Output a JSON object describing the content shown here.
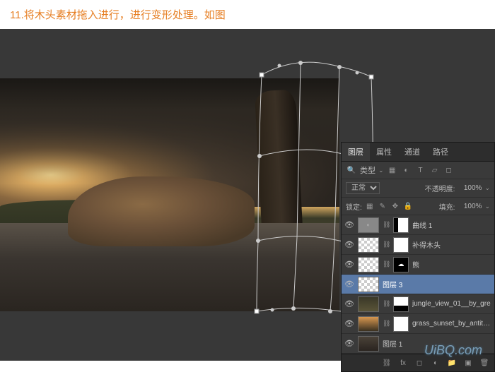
{
  "step": "11.将木头素材拖入进行，进行变形处理。如图",
  "watermark": "UiBQ.com",
  "panel": {
    "tabs": [
      "图层",
      "属性",
      "通道",
      "路径"
    ],
    "active_tab": "图层",
    "filter_label": "类型",
    "blend_mode": "正常",
    "opacity_label": "不透明度:",
    "opacity_value": "100%",
    "lock_label": "锁定:",
    "fill_label": "填充:",
    "fill_value": "100%"
  },
  "layers": [
    {
      "name": "曲线 1",
      "type": "adjust",
      "masked": true,
      "sel": false
    },
    {
      "name": "补得木头",
      "type": "trans",
      "masked": true,
      "sel": false
    },
    {
      "name": "熊",
      "type": "trans",
      "masked": true,
      "sel": false
    },
    {
      "name": "图层 3",
      "type": "trans",
      "masked": false,
      "sel": true
    },
    {
      "name": "jungle_view_01__by_gre",
      "type": "img1",
      "masked": true,
      "sel": false
    },
    {
      "name": "grass_sunset_by_antithisis_stock",
      "type": "img2",
      "masked": true,
      "sel": false
    },
    {
      "name": "图层 1",
      "type": "img3",
      "masked": false,
      "sel": false
    }
  ]
}
